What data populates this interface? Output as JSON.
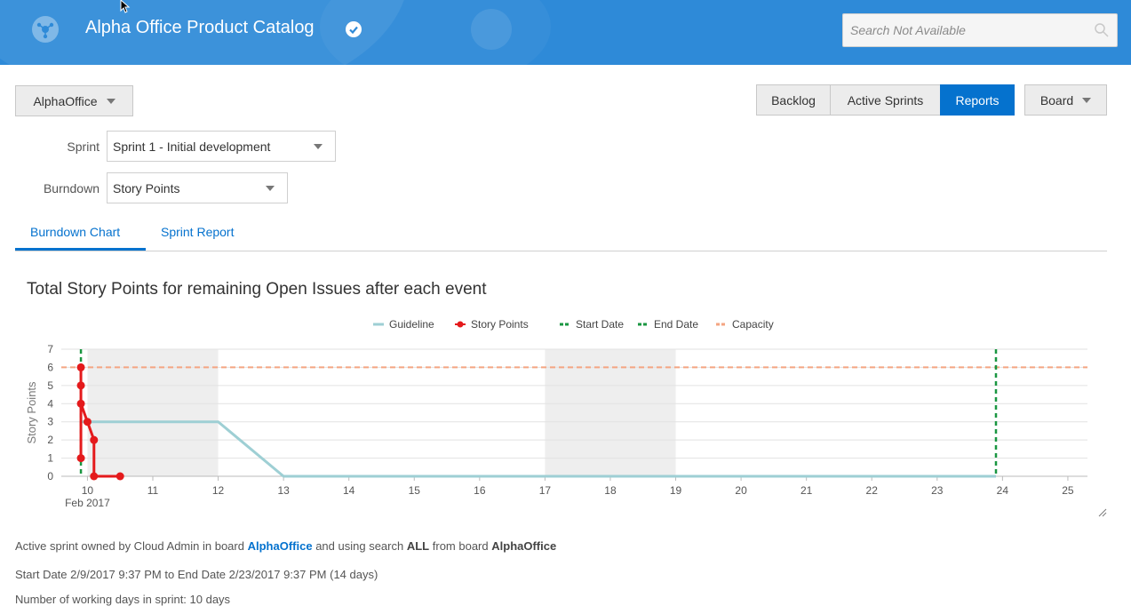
{
  "header": {
    "title": "Alpha Office Product Catalog",
    "search_placeholder": "Search Not Available"
  },
  "toolbar": {
    "board_selector": "AlphaOffice",
    "views": [
      "Backlog",
      "Active Sprints",
      "Reports"
    ],
    "active_view": "Reports",
    "board_menu": "Board"
  },
  "filters": {
    "sprint_label": "Sprint",
    "sprint_value": "Sprint 1 - Initial development",
    "burndown_label": "Burndown",
    "burndown_value": "Story Points"
  },
  "tabs": [
    {
      "label": "Burndown Chart",
      "active": true
    },
    {
      "label": "Sprint Report",
      "active": false
    }
  ],
  "chart_data": {
    "type": "line",
    "title": "Total Story Points for remaining Open Issues after each event",
    "ylabel": "Story Points",
    "xlabel": "",
    "x_date_label": "Feb 2017",
    "ylim": [
      0,
      7
    ],
    "xlim": [
      9.6,
      25.3
    ],
    "y_ticks": [
      0,
      1,
      2,
      3,
      4,
      5,
      6,
      7
    ],
    "x_ticks": [
      10,
      11,
      12,
      13,
      14,
      15,
      16,
      17,
      18,
      19,
      20,
      21,
      22,
      23,
      24,
      25
    ],
    "legend": [
      {
        "name": "Guideline",
        "color": "#9ecfd4",
        "style": "line"
      },
      {
        "name": "Story Points",
        "color": "#e41a1c",
        "style": "line-dot"
      },
      {
        "name": "Start Date",
        "color": "#1a9641",
        "style": "dash"
      },
      {
        "name": "End Date",
        "color": "#1a9641",
        "style": "dash"
      },
      {
        "name": "Capacity",
        "color": "#f4a582",
        "style": "dash"
      }
    ],
    "legend_position": "top-center",
    "weekend_bands": [
      [
        10,
        12
      ],
      [
        17,
        19
      ]
    ],
    "series": [
      {
        "name": "Guideline",
        "points": [
          [
            9.9,
            3
          ],
          [
            12,
            3
          ],
          [
            13,
            0
          ],
          [
            23.9,
            0
          ]
        ]
      },
      {
        "name": "Story Points",
        "points": [
          [
            9.9,
            1
          ],
          [
            9.9,
            6
          ],
          [
            9.9,
            5
          ],
          [
            9.9,
            4
          ],
          [
            10.0,
            3
          ],
          [
            10.1,
            2
          ],
          [
            10.1,
            0
          ],
          [
            10.5,
            0
          ]
        ]
      }
    ],
    "start_date_x": 9.9,
    "end_date_x": 23.9,
    "capacity": 6
  },
  "info": {
    "line1_prefix": "Active sprint owned by Cloud Admin in board",
    "line1_board": "AlphaOffice",
    "line1_mid": "and using search",
    "line1_search": "ALL",
    "line1_from": "from board",
    "line1_board2": "AlphaOffice",
    "line2": "Start Date 2/9/2017 9:37 PM to End Date 2/23/2017 9:37 PM (14 days)",
    "line3": "Number of working days in sprint: 10 days"
  }
}
